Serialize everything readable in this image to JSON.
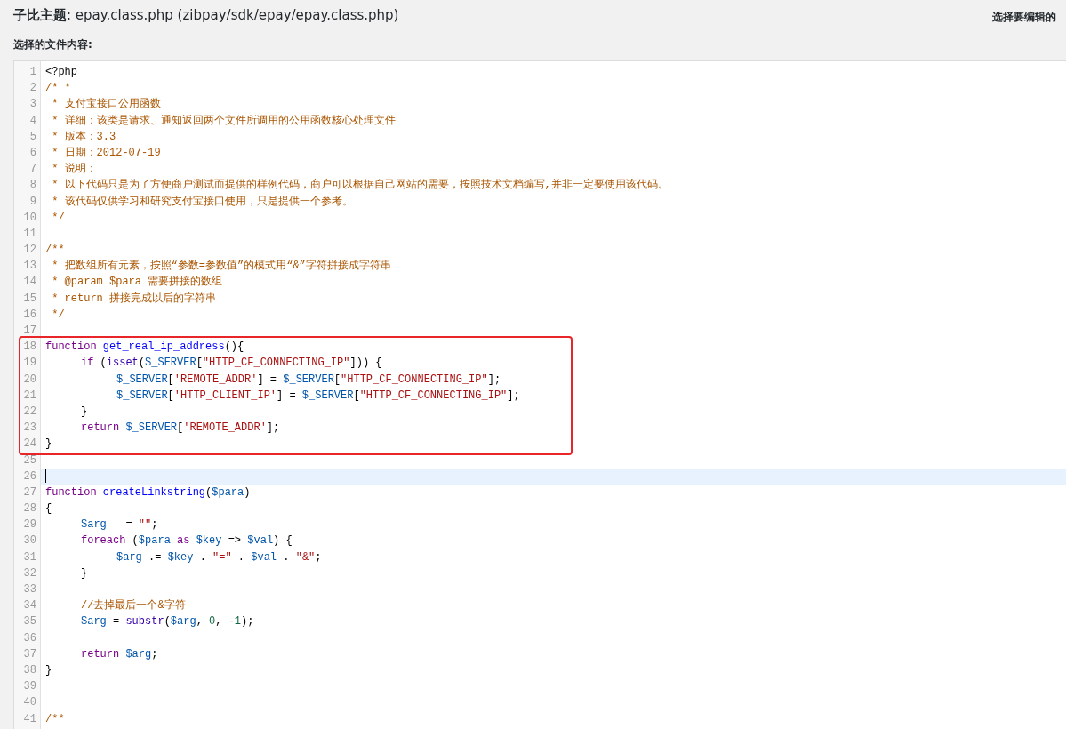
{
  "header": {
    "title": "**子比主题**: epay.class.php (zibpay/sdk/epay/epay.class.php)",
    "right_label": "选择要编辑的"
  },
  "content_label": "选择的文件内容:",
  "lines": [
    {
      "kind": "code",
      "number": "1",
      "tokens": [
        {
          "kind": "plain",
          "text": "<?php"
        }
      ]
    },
    {
      "kind": "code",
      "number": "2",
      "tokens": [
        {
          "kind": "comment",
          "text": "/* *"
        }
      ]
    },
    {
      "kind": "code",
      "number": "3",
      "tokens": [
        {
          "kind": "comment",
          "text": " * 支付宝接口公用函数"
        }
      ]
    },
    {
      "kind": "code",
      "number": "4",
      "tokens": [
        {
          "kind": "comment",
          "text": " * 详细：该类是请求、通知返回两个文件所调用的公用函数核心处理文件"
        }
      ]
    },
    {
      "kind": "code",
      "number": "5",
      "tokens": [
        {
          "kind": "comment",
          "text": " * 版本：3.3"
        }
      ]
    },
    {
      "kind": "code",
      "number": "6",
      "tokens": [
        {
          "kind": "comment",
          "text": " * 日期：2012-07-19"
        }
      ]
    },
    {
      "kind": "code",
      "number": "7",
      "tokens": [
        {
          "kind": "comment",
          "text": " * 说明："
        }
      ]
    },
    {
      "kind": "code",
      "number": "8",
      "tokens": [
        {
          "kind": "comment",
          "text": " * 以下代码只是为了方便商户测试而提供的样例代码，商户可以根据自己网站的需要，按照技术文档编写,并非一定要使用该代码。"
        }
      ]
    },
    {
      "kind": "code",
      "number": "9",
      "tokens": [
        {
          "kind": "comment",
          "text": " * 该代码仅供学习和研究支付宝接口使用，只是提供一个参考。"
        }
      ]
    },
    {
      "kind": "code",
      "number": "10",
      "tokens": [
        {
          "kind": "comment",
          "text": " */"
        }
      ]
    },
    {
      "kind": "code",
      "number": "11"
    },
    {
      "kind": "code",
      "number": "12",
      "tokens": [
        {
          "kind": "comment",
          "text": "/**"
        }
      ]
    },
    {
      "kind": "code",
      "number": "13",
      "tokens": [
        {
          "kind": "comment",
          "text": " * 把数组所有元素，按照“参数=参数值”的模式用“&”字符拼接成字符串"
        }
      ]
    },
    {
      "kind": "code",
      "number": "14",
      "tokens": [
        {
          "kind": "comment",
          "text": " * @param $para 需要拼接的数组"
        }
      ]
    },
    {
      "kind": "code",
      "number": "15",
      "tokens": [
        {
          "kind": "comment",
          "text": " * return 拼接完成以后的字符串"
        }
      ]
    },
    {
      "kind": "code",
      "number": "16",
      "tokens": [
        {
          "kind": "comment",
          "text": " */"
        }
      ]
    },
    {
      "kind": "code",
      "number": "17"
    },
    {
      "kind": "boxed_group",
      "lines": [
        {
          "kind": "code",
          "number": "18",
          "tokens": [
            {
              "kind": "keyword",
              "text": "function "
            },
            {
              "kind": "def",
              "text": "get_real_ip_address"
            },
            {
              "kind": "plain",
              "text": "(){"
            }
          ]
        },
        {
          "kind": "code",
          "number": "19",
          "tokens": [
            {
              "kind": "keyword",
              "text": "\tif"
            },
            {
              "kind": "plain",
              "text": " ("
            },
            {
              "kind": "builtin",
              "text": "isset"
            },
            {
              "kind": "plain",
              "text": "("
            },
            {
              "kind": "variable",
              "text": "$_SERVER"
            },
            {
              "kind": "plain",
              "text": "["
            },
            {
              "kind": "string",
              "text": "\"HTTP_CF_CONNECTING_IP\""
            },
            {
              "kind": "plain",
              "text": "])) {"
            }
          ]
        },
        {
          "kind": "code",
          "number": "20",
          "tokens": [
            {
              "kind": "variable",
              "text": "\t\t$_SERVER"
            },
            {
              "kind": "plain",
              "text": "["
            },
            {
              "kind": "string",
              "text": "'REMOTE_ADDR'"
            },
            {
              "kind": "plain",
              "text": "] = "
            },
            {
              "kind": "variable",
              "text": "$_SERVER"
            },
            {
              "kind": "plain",
              "text": "["
            },
            {
              "kind": "string",
              "text": "\"HTTP_CF_CONNECTING_IP\""
            },
            {
              "kind": "plain",
              "text": "];"
            }
          ]
        },
        {
          "kind": "code",
          "number": "21",
          "tokens": [
            {
              "kind": "variable",
              "text": "\t\t$_SERVER"
            },
            {
              "kind": "plain",
              "text": "["
            },
            {
              "kind": "string",
              "text": "'HTTP_CLIENT_IP'"
            },
            {
              "kind": "plain",
              "text": "] = "
            },
            {
              "kind": "variable",
              "text": "$_SERVER"
            },
            {
              "kind": "plain",
              "text": "["
            },
            {
              "kind": "string",
              "text": "\"HTTP_CF_CONNECTING_IP\""
            },
            {
              "kind": "plain",
              "text": "];"
            }
          ]
        },
        {
          "kind": "code",
          "number": "22",
          "tokens": [
            {
              "kind": "plain",
              "text": "\t}"
            }
          ]
        },
        {
          "kind": "code",
          "number": "23",
          "tokens": [
            {
              "kind": "keyword",
              "text": "\treturn "
            },
            {
              "kind": "variable",
              "text": "$_SERVER"
            },
            {
              "kind": "plain",
              "text": "["
            },
            {
              "kind": "string",
              "text": "'REMOTE_ADDR'"
            },
            {
              "kind": "plain",
              "text": "];"
            }
          ]
        },
        {
          "kind": "code",
          "number": "24",
          "tokens": [
            {
              "kind": "plain",
              "text": "}"
            }
          ]
        }
      ]
    },
    {
      "kind": "code",
      "number": "25"
    },
    {
      "kind": "cursor_line",
      "number": "26"
    },
    {
      "kind": "code",
      "number": "27",
      "tokens": [
        {
          "kind": "keyword",
          "text": "function "
        },
        {
          "kind": "def",
          "text": "createLinkstring"
        },
        {
          "kind": "plain",
          "text": "("
        },
        {
          "kind": "variable",
          "text": "$para"
        },
        {
          "kind": "plain",
          "text": ")"
        }
      ]
    },
    {
      "kind": "code",
      "number": "28",
      "tokens": [
        {
          "kind": "plain",
          "text": "{"
        }
      ]
    },
    {
      "kind": "code",
      "number": "29",
      "tokens": [
        {
          "kind": "variable",
          "text": "\t$arg"
        },
        {
          "kind": "plain",
          "text": "   = "
        },
        {
          "kind": "string",
          "text": "\"\""
        },
        {
          "kind": "plain",
          "text": ";"
        }
      ]
    },
    {
      "kind": "code",
      "number": "30",
      "tokens": [
        {
          "kind": "keyword",
          "text": "\tforeach"
        },
        {
          "kind": "plain",
          "text": " ("
        },
        {
          "kind": "variable",
          "text": "$para "
        },
        {
          "kind": "keyword",
          "text": "as "
        },
        {
          "kind": "variable",
          "text": "$key"
        },
        {
          "kind": "plain",
          "text": " => "
        },
        {
          "kind": "variable",
          "text": "$val"
        },
        {
          "kind": "plain",
          "text": ") {"
        }
      ]
    },
    {
      "kind": "code",
      "number": "31",
      "tokens": [
        {
          "kind": "variable",
          "text": "\t\t$arg"
        },
        {
          "kind": "plain",
          "text": " .= "
        },
        {
          "kind": "variable",
          "text": "$key"
        },
        {
          "kind": "plain",
          "text": " . "
        },
        {
          "kind": "string",
          "text": "\"=\""
        },
        {
          "kind": "plain",
          "text": " . "
        },
        {
          "kind": "variable",
          "text": "$val"
        },
        {
          "kind": "plain",
          "text": " . "
        },
        {
          "kind": "string",
          "text": "\"&\""
        },
        {
          "kind": "plain",
          "text": ";"
        }
      ]
    },
    {
      "kind": "code",
      "number": "32",
      "tokens": [
        {
          "kind": "plain",
          "text": "\t}"
        }
      ]
    },
    {
      "kind": "code",
      "number": "33"
    },
    {
      "kind": "code",
      "number": "34",
      "tokens": [
        {
          "kind": "comment",
          "text": "\t//去掉最后一个&字符"
        }
      ]
    },
    {
      "kind": "code",
      "number": "35",
      "tokens": [
        {
          "kind": "variable",
          "text": "\t$arg"
        },
        {
          "kind": "plain",
          "text": " = "
        },
        {
          "kind": "builtin",
          "text": "substr"
        },
        {
          "kind": "plain",
          "text": "("
        },
        {
          "kind": "variable",
          "text": "$arg"
        },
        {
          "kind": "plain",
          "text": ", "
        },
        {
          "kind": "number",
          "text": "0"
        },
        {
          "kind": "plain",
          "text": ", "
        },
        {
          "kind": "number",
          "text": "-1"
        },
        {
          "kind": "plain",
          "text": ");"
        }
      ]
    },
    {
      "kind": "code",
      "number": "36"
    },
    {
      "kind": "code",
      "number": "37",
      "tokens": [
        {
          "kind": "keyword",
          "text": "\treturn "
        },
        {
          "kind": "variable",
          "text": "$arg"
        },
        {
          "kind": "plain",
          "text": ";"
        }
      ]
    },
    {
      "kind": "code",
      "number": "38",
      "tokens": [
        {
          "kind": "plain",
          "text": "}"
        }
      ]
    },
    {
      "kind": "code",
      "number": "39"
    },
    {
      "kind": "code",
      "number": "40"
    },
    {
      "kind": "code",
      "number": "41",
      "tokens": [
        {
          "kind": "comment",
          "text": "/**"
        }
      ]
    }
  ]
}
